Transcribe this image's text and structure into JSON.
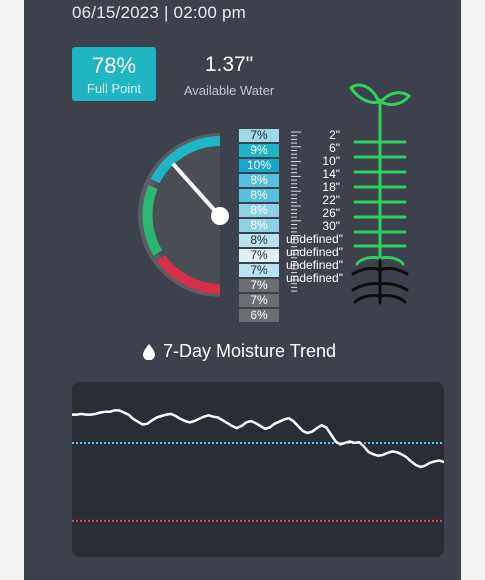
{
  "header": {
    "timestamp": "06/15/2023 | 02:00 pm"
  },
  "summary": {
    "full_point_value": "78%",
    "full_point_label": "Full Point",
    "available_water_value": "1.37\"",
    "available_water_label": "Available Water"
  },
  "gauge": {
    "level_fraction": 0.78
  },
  "moisture_by_depth": [
    {
      "pct": "7%",
      "depth": "2\"",
      "color": "#9ed9e8"
    },
    {
      "pct": "9%",
      "depth": "6\"",
      "color": "#1fb5c2"
    },
    {
      "pct": "10%",
      "depth": "10\"",
      "color": "#1aa6cf"
    },
    {
      "pct": "8%",
      "depth": "14\"",
      "color": "#58c0dd"
    },
    {
      "pct": "8%",
      "depth": "18\"",
      "color": "#58c0dd"
    },
    {
      "pct": "8%",
      "depth": "22\"",
      "color": "#8ed0e6"
    },
    {
      "pct": "8%",
      "depth": "26\"",
      "color": "#8ed0e6"
    },
    {
      "pct": "8%",
      "depth": "30\"",
      "color": "#b7e3f0"
    },
    {
      "pct": "7%",
      "depth": "undefined\"",
      "color": "#ddf1f7"
    },
    {
      "pct": "7%",
      "depth": "undefined\"",
      "color": "#b7e3f0"
    },
    {
      "pct": "7%",
      "depth": "undefined\"",
      "color": "#6b6e73"
    },
    {
      "pct": "7%",
      "depth": "undefined\"",
      "color": "#6b6e73"
    },
    {
      "pct": "6%",
      "depth": "",
      "color": "#6b6e73"
    }
  ],
  "trend": {
    "title": "7-Day Moisture Trend",
    "upper_line_color": "#4fc3f7",
    "lower_line_color": "#e0474c"
  },
  "chart_data": {
    "type": "line",
    "title": "7-Day Moisture Trend",
    "series": [
      {
        "values": [
          0.4,
          0.4,
          0.41,
          0.4,
          0.4,
          0.41,
          0.43,
          0.44,
          0.44,
          0.46,
          0.46,
          0.43,
          0.4,
          0.34,
          0.3,
          0.26,
          0.27,
          0.32,
          0.36,
          0.38,
          0.4,
          0.41,
          0.38,
          0.34,
          0.31,
          0.29,
          0.31,
          0.34,
          0.37,
          0.39,
          0.37,
          0.36,
          0.32,
          0.28,
          0.24,
          0.21,
          0.24,
          0.29,
          0.31,
          0.28,
          0.24,
          0.2,
          0.22,
          0.27,
          0.3,
          0.33,
          0.35,
          0.31,
          0.24,
          0.17,
          0.14,
          0.16,
          0.21,
          0.25,
          0.22,
          0.12,
          0.02,
          -0.02,
          0.0,
          0.02,
          0.0,
          0.01,
          -0.05,
          -0.13,
          -0.16,
          -0.18,
          -0.17,
          -0.14,
          -0.12,
          -0.13,
          -0.16,
          -0.2,
          -0.26,
          -0.31,
          -0.34,
          -0.32,
          -0.28,
          -0.26,
          -0.25,
          -0.27
        ]
      }
    ],
    "reference_lines": [
      {
        "y": 0
      },
      {
        "y": -1.1
      }
    ],
    "ylim": [
      -1.3,
      0.55
    ],
    "grid": false
  }
}
